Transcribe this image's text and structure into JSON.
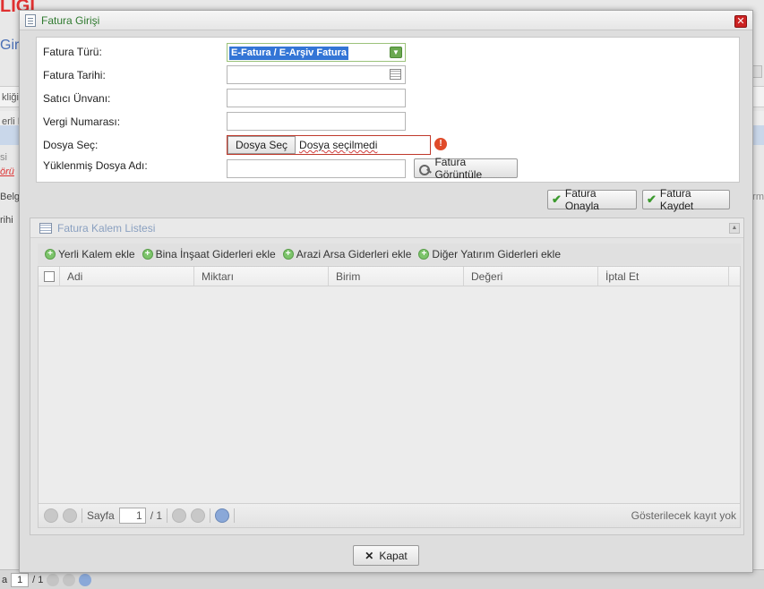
{
  "background": {
    "title_fragment": "LIĞI",
    "giri_fragment": "Giri",
    "row1_fragment": "kliği",
    "row2_fragment": "erli L",
    "si_fragment": "si",
    "sor_fragment": "örü",
    "belge_fragment": "Belge",
    "rihi_fragment": "rihi",
    "rm_fragment": "rm",
    "bottom_a": "a",
    "bottom_page": "1",
    "bottom_total": "/ 1"
  },
  "dialog": {
    "title": "Fatura Girişi",
    "close_symbol": "✕",
    "form": {
      "fatura_turu_label": "Fatura Türü:",
      "fatura_turu_value": "E-Fatura / E-Arşiv Fatura",
      "fatura_tarihi_label": "Fatura Tarihi:",
      "fatura_tarihi_value": "",
      "satici_unvani_label": "Satıcı Ünvanı:",
      "satici_unvani_value": "",
      "vergi_numarasi_label": "Vergi Numarası:",
      "vergi_numarasi_value": "",
      "dosya_sec_label": "Dosya Seç:",
      "dosya_sec_button": "Dosya Seç",
      "dosya_sec_status": "Dosya seçilmedi",
      "yuklenmis_dosya_label": "Yüklenmiş Dosya Adı:",
      "yuklenmis_dosya_value": "",
      "fatura_goruntule_button": "Fatura Görüntüle"
    },
    "actions": {
      "onayla_button": "Fatura Onayla",
      "kaydet_button": "Fatura Kaydet"
    },
    "list": {
      "title": "Fatura Kalem Listesi",
      "toolbar": [
        "Yerli Kalem ekle",
        "Bina İnşaat Giderleri ekle",
        "Arazi Arsa Giderleri ekle",
        "Diğer Yatırım Giderleri ekle"
      ],
      "columns": [
        "Adi",
        "Miktarı",
        "Birim",
        "Değeri",
        "İptal Et"
      ],
      "pager": {
        "page_label": "Sayfa",
        "page_value": "1",
        "page_total": "/ 1",
        "info": "Gösterilecek kayıt yok"
      }
    },
    "close_button": "Kapat"
  },
  "colors": {
    "title_green": "#2f7a2f",
    "select_highlight": "#3375d6",
    "error_red": "#c0392b",
    "accent_green": "#3c9a2e"
  }
}
